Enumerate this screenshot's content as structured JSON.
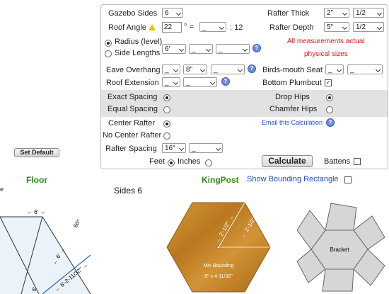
{
  "form": {
    "gazebo_sides_label": "Gazebo Sides",
    "gazebo_sides_value": "6",
    "rafter_thick_label": "Rafter Thick",
    "rafter_thick_value": "2\"",
    "rafter_thick_frac": "1/2",
    "roof_angle_label": "Roof Angle",
    "roof_angle_value": "22",
    "degree_suffix": "° =",
    "pitch_value": "_",
    "pitch_ratio": ": 12",
    "rafter_depth_label": "Rafter Depth",
    "rafter_depth_value": "5\"",
    "rafter_depth_frac": "1/2",
    "radius_label": "Radius (level)",
    "side_lengths_label": "Side Lengths",
    "size_feet": "6'",
    "size_inches": "_",
    "size_frac": "_",
    "note_line1": "All measurements actual",
    "note_line2": "physical sizes",
    "eave_overhang_label": "Eave Overhang",
    "eave_feet": "_",
    "eave_inches": "8\"",
    "eave_frac": "_",
    "birds_mouth_label": "Birds-mouth Seat",
    "birds_inches": "_",
    "birds_frac": "_",
    "roof_extension_label": "Roof Extension",
    "roof_ext_inches": "_",
    "roof_ext_frac": "_",
    "bottom_plumbcut_label": "Bottom Plumbcut",
    "bottom_plumbcut_mark": "✓",
    "exact_spacing_label": "Exact Spacing",
    "equal_spacing_label": "Equal Spacing",
    "drop_hips_label": "Drop Hips",
    "chamfer_hips_label": "Chamfer Hips",
    "center_rafter_label": "Center Rafter",
    "no_center_rafter_label": "No Center Rafter",
    "email_label": "Email this Calculation",
    "rafter_spacing_label": "Rafter Spacing",
    "rafter_spacing_value": "16\"",
    "rafter_spacing_frac": "_",
    "calculate_label": "Calculate",
    "battens_label": "Battens",
    "feet_label": "Feet",
    "inches_label": "Inches",
    "help_glyph": "?"
  },
  "set_default_label": "Set Default",
  "floor_label": "Floor",
  "sides_title": "Sides 6",
  "kingpost_label": "KingPost",
  "show_bounding_label": "Show Bounding Rectangle",
  "edge_char": "e",
  "floor_diagram": {
    "top_dim": "← 6' →",
    "side_dim": "60°",
    "inner_dim": "← 6' →",
    "diag_dim": "← 6'-2-11/32\" →",
    "bottom_dim": "6'"
  },
  "kingpost_diagram": {
    "dim_a": "← 2'-1/2\" →",
    "dim_b": "← 2'-1/2\" →",
    "min_bounding_label": "Min Bounding",
    "min_bounding_value": "5\" x 4-11/32\""
  },
  "bracket_label": "Bracket",
  "colors": {
    "panel_shade": "#e2e2e2",
    "green": "#2e8b1a",
    "blue": "#1a4fc0",
    "red": "#e01010",
    "wood": "#c58a2a"
  }
}
